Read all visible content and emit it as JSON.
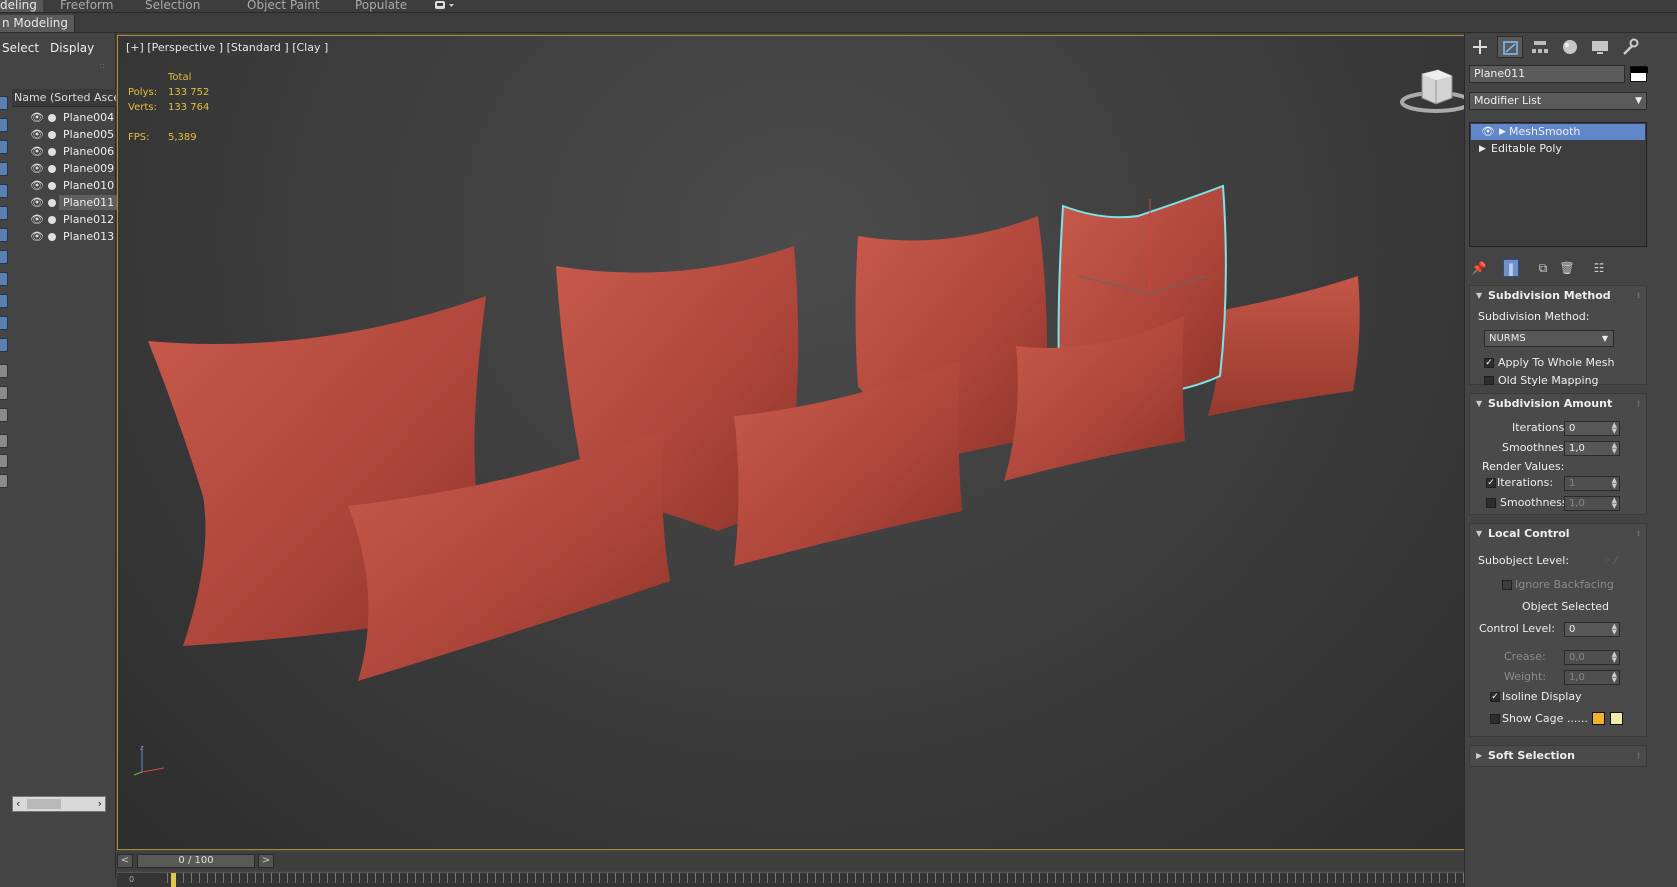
{
  "ribbon": {
    "tabs": [
      "deling",
      "Freeform",
      "Selection",
      "Object Paint",
      "Populate"
    ],
    "sub_label": "n Modeling"
  },
  "scene_explorer": {
    "tabs": [
      "Select",
      "Display"
    ],
    "column_header": "Name (Sorted Ascen",
    "items": [
      {
        "name": "Plane004",
        "selected": false
      },
      {
        "name": "Plane005",
        "selected": false
      },
      {
        "name": "Plane006",
        "selected": false
      },
      {
        "name": "Plane009",
        "selected": false
      },
      {
        "name": "Plane010",
        "selected": false
      },
      {
        "name": "Plane011",
        "selected": true
      },
      {
        "name": "Plane012",
        "selected": false
      },
      {
        "name": "Plane013",
        "selected": false
      }
    ]
  },
  "viewport": {
    "label": "[+] [Perspective ] [Standard ] [Clay ]",
    "stats": {
      "total_label": "Total",
      "polys_label": "Polys:",
      "polys": "133 752",
      "verts_label": "Verts:",
      "verts": "133 764",
      "fps_label": "FPS:",
      "fps": "5,389"
    },
    "pillow_color": "#b5483d",
    "selection_color": "#7fe3e6"
  },
  "timeline": {
    "prev": "<",
    "next": ">",
    "slider": "0 / 100",
    "track_zero": "0"
  },
  "command_panel": {
    "tab_icons": [
      "create-icon",
      "modify-icon",
      "hierarchy-icon",
      "motion-icon",
      "display-icon",
      "utilities-icon"
    ],
    "object_name": "Plane011",
    "modifier_list": "Modifier List",
    "stack": [
      {
        "label": "MeshSmooth",
        "selected": true
      },
      {
        "label": "Editable Poly",
        "selected": false
      }
    ],
    "subdivision_method": {
      "title": "Subdivision Method",
      "method_label": "Subdivision Method:",
      "method_value": "NURMS",
      "apply_whole": "Apply To Whole Mesh",
      "apply_whole_checked": true,
      "old_style": "Old Style Mapping",
      "old_style_checked": false
    },
    "subdivision_amount": {
      "title": "Subdivision Amount",
      "iterations_label": "Iterations:",
      "iterations": "0",
      "smoothness_label": "Smoothness:",
      "smoothness": "1,0",
      "render_values": "Render Values:",
      "render_iterations_label": "Iterations:",
      "render_iterations": "1",
      "render_iterations_checked": true,
      "render_smoothness_label": "Smoothness:",
      "render_smoothness": "1,0",
      "render_smoothness_checked": false
    },
    "local_control": {
      "title": "Local Control",
      "subobject_label": "Subobject Level:",
      "ignore_backfacing": "Ignore Backfacing",
      "object_selected": "Object Selected",
      "control_level_label": "Control Level:",
      "control_level": "0",
      "crease_label": "Crease:",
      "crease": "0,0",
      "weight_label": "Weight:",
      "weight": "1,0",
      "isoline": "Isoline Display",
      "isoline_checked": true,
      "show_cage": "Show Cage ......",
      "show_cage_checked": false,
      "cage_color_1": "#f0b429",
      "cage_color_2": "#f3e9a8"
    },
    "soft_selection": {
      "title": "Soft Selection"
    }
  }
}
